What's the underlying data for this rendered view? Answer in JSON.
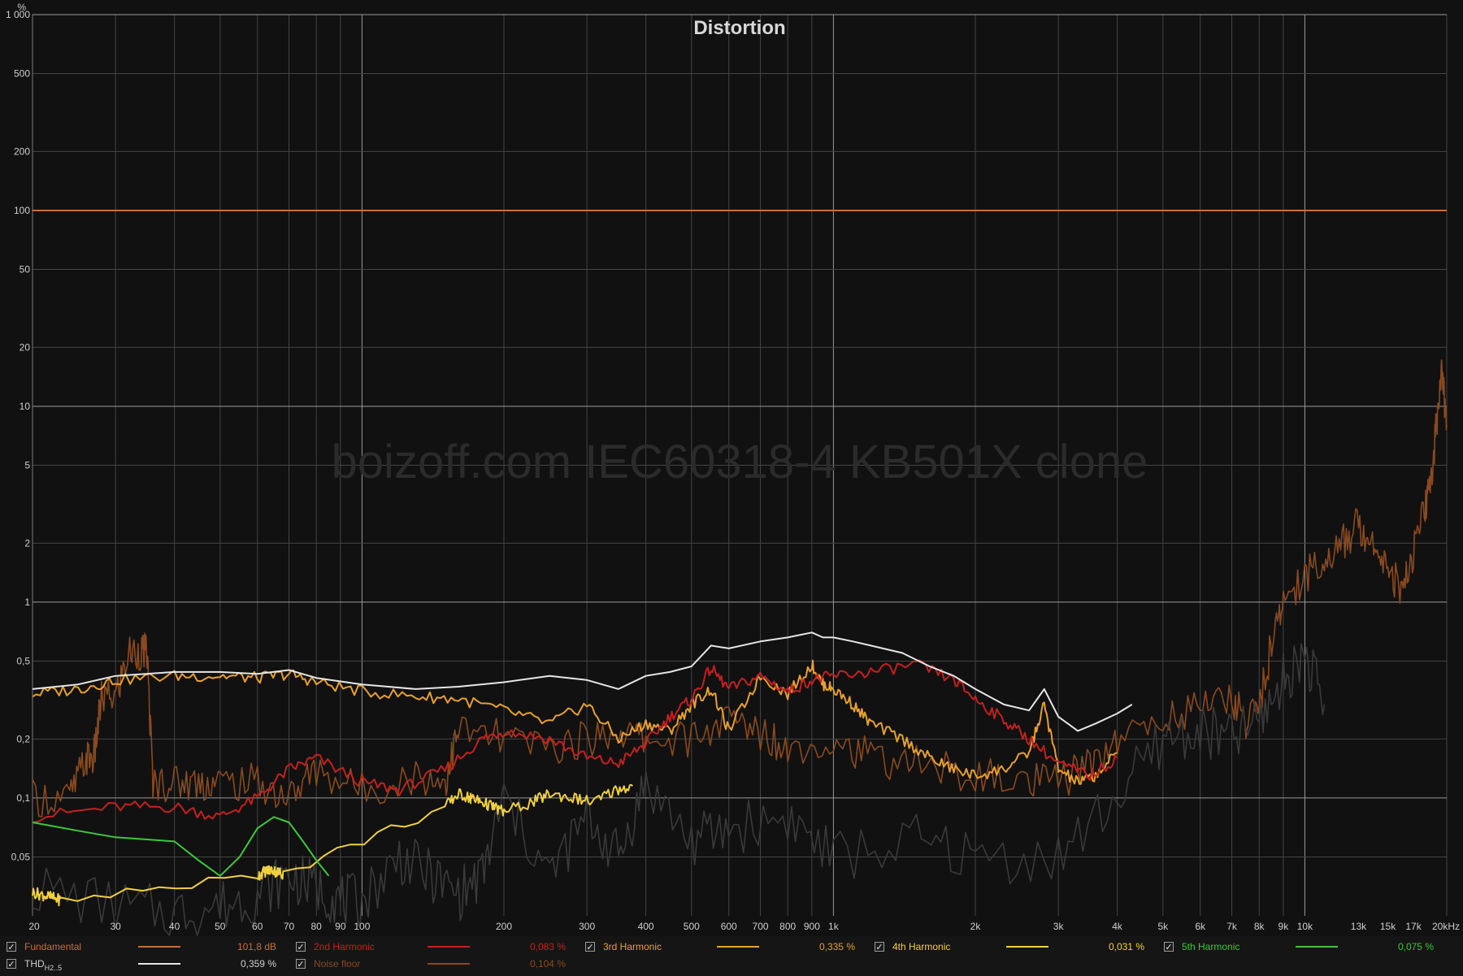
{
  "chart_data": {
    "type": "line",
    "title": "Distortion",
    "watermark": "boizoff.com IEC60318-4 KB501X clone",
    "x_scale": "log",
    "y_scale": "log",
    "xlim": [
      20,
      20000
    ],
    "ylim": [
      0.025,
      1000
    ],
    "y_unit": "%",
    "x_unit": "kHz",
    "grid": true,
    "y_ticks": [
      {
        "v": 1000,
        "label": "1 000"
      },
      {
        "v": 500,
        "label": "500"
      },
      {
        "v": 200,
        "label": "200"
      },
      {
        "v": 100,
        "label": "100"
      },
      {
        "v": 50,
        "label": "50"
      },
      {
        "v": 20,
        "label": "20"
      },
      {
        "v": 10,
        "label": "10"
      },
      {
        "v": 5,
        "label": "5"
      },
      {
        "v": 2,
        "label": "2"
      },
      {
        "v": 1,
        "label": "1"
      },
      {
        "v": 0.5,
        "label": "0,5"
      },
      {
        "v": 0.2,
        "label": "0,2"
      },
      {
        "v": 0.1,
        "label": "0,1"
      },
      {
        "v": 0.05,
        "label": "0,05"
      }
    ],
    "x_ticks": [
      {
        "v": 20,
        "label": "20"
      },
      {
        "v": 30,
        "label": "30"
      },
      {
        "v": 40,
        "label": "40"
      },
      {
        "v": 50,
        "label": "50"
      },
      {
        "v": 60,
        "label": "60"
      },
      {
        "v": 70,
        "label": "70"
      },
      {
        "v": 80,
        "label": "80"
      },
      {
        "v": 90,
        "label": "90"
      },
      {
        "v": 100,
        "label": "100"
      },
      {
        "v": 200,
        "label": "200"
      },
      {
        "v": 300,
        "label": "300"
      },
      {
        "v": 400,
        "label": "400"
      },
      {
        "v": 500,
        "label": "500"
      },
      {
        "v": 600,
        "label": "600"
      },
      {
        "v": 700,
        "label": "700"
      },
      {
        "v": 800,
        "label": "800"
      },
      {
        "v": 900,
        "label": "900"
      },
      {
        "v": 1000,
        "label": "1k"
      },
      {
        "v": 2000,
        "label": "2k"
      },
      {
        "v": 3000,
        "label": "3k"
      },
      {
        "v": 4000,
        "label": "4k"
      },
      {
        "v": 5000,
        "label": "5k"
      },
      {
        "v": 6000,
        "label": "6k"
      },
      {
        "v": 7000,
        "label": "7k"
      },
      {
        "v": 8000,
        "label": "8k"
      },
      {
        "v": 9000,
        "label": "9k"
      },
      {
        "v": 10000,
        "label": "10k"
      },
      {
        "v": 13000,
        "label": "13k"
      },
      {
        "v": 15000,
        "label": "15k"
      },
      {
        "v": 17000,
        "label": "17k"
      },
      {
        "v": 20000,
        "label": "20kHz"
      }
    ],
    "series": [
      {
        "name": "Fundamental",
        "color": "#c5703a",
        "value_label": "101,8 dB",
        "x": [
          20,
          20000
        ],
        "y": [
          100,
          100
        ]
      },
      {
        "name": "THD",
        "name_sub": "H2..5",
        "color": "#e6e6e6",
        "value_label": "0,359 %",
        "x": [
          20,
          25,
          30,
          40,
          50,
          60,
          70,
          80,
          100,
          130,
          160,
          200,
          250,
          300,
          350,
          400,
          450,
          500,
          550,
          600,
          700,
          800,
          900,
          950,
          1000,
          1100,
          1200,
          1400,
          1600,
          1800,
          2000,
          2300,
          2600,
          2800,
          3000,
          3300,
          3600,
          4000,
          4300
        ],
        "y": [
          0.36,
          0.38,
          0.42,
          0.44,
          0.44,
          0.43,
          0.45,
          0.41,
          0.38,
          0.36,
          0.37,
          0.39,
          0.42,
          0.4,
          0.36,
          0.42,
          0.44,
          0.47,
          0.6,
          0.58,
          0.63,
          0.66,
          0.7,
          0.66,
          0.66,
          0.63,
          0.6,
          0.55,
          0.47,
          0.42,
          0.36,
          0.3,
          0.28,
          0.36,
          0.26,
          0.22,
          0.24,
          0.27,
          0.3
        ]
      },
      {
        "name": "2nd Harmonic",
        "color": "#c42020",
        "value_label": "0,083 %",
        "x": [
          20,
          30,
          40,
          50,
          60,
          70,
          80,
          100,
          120,
          150,
          180,
          200,
          250,
          300,
          350,
          400,
          450,
          500,
          550,
          600,
          700,
          800,
          900,
          1000,
          1200,
          1500,
          1800,
          2000,
          2300,
          2600,
          3000,
          3500,
          4000
        ],
        "y": [
          0.08,
          0.09,
          0.09,
          0.08,
          0.1,
          0.14,
          0.16,
          0.12,
          0.11,
          0.14,
          0.2,
          0.22,
          0.2,
          0.16,
          0.15,
          0.19,
          0.26,
          0.32,
          0.46,
          0.36,
          0.42,
          0.35,
          0.4,
          0.42,
          0.44,
          0.48,
          0.4,
          0.32,
          0.25,
          0.2,
          0.15,
          0.13,
          0.16
        ]
      },
      {
        "name": "3rd Harmonic",
        "color": "#e8a030",
        "value_label": "0,335 %",
        "x": [
          20,
          25,
          30,
          40,
          50,
          60,
          70,
          80,
          100,
          130,
          160,
          200,
          250,
          300,
          350,
          400,
          450,
          500,
          550,
          600,
          700,
          800,
          900,
          950,
          1000,
          1100,
          1200,
          1400,
          1600,
          1800,
          2000,
          2300,
          2600,
          2800,
          3000,
          3300,
          3600,
          4000
        ],
        "y": [
          0.34,
          0.36,
          0.4,
          0.42,
          0.42,
          0.41,
          0.43,
          0.39,
          0.35,
          0.33,
          0.32,
          0.28,
          0.24,
          0.3,
          0.2,
          0.24,
          0.22,
          0.3,
          0.36,
          0.22,
          0.42,
          0.34,
          0.48,
          0.38,
          0.36,
          0.3,
          0.24,
          0.2,
          0.16,
          0.14,
          0.13,
          0.14,
          0.17,
          0.3,
          0.14,
          0.12,
          0.13,
          0.17
        ]
      },
      {
        "name": "4th Harmonic",
        "color": "#f0d040",
        "value_label": "0,031 %",
        "x": [
          20,
          21,
          22,
          23,
          60,
          62,
          64,
          66,
          68,
          150,
          160,
          170,
          170,
          180,
          190,
          200,
          230,
          250,
          280,
          310,
          345,
          375
        ],
        "y": [
          0.033,
          0.032,
          0.031,
          0.03,
          0.04,
          0.042,
          0.043,
          0.042,
          0.041,
          0.09,
          0.105,
          0.1,
          0.1,
          0.095,
          0.09,
          0.085,
          0.095,
          0.105,
          0.1,
          0.095,
          0.11,
          0.115
        ]
      },
      {
        "name": "5th Harmonic",
        "color": "#3cc83c",
        "value_label": "0,075 %",
        "x": [
          20,
          25,
          30,
          40,
          45,
          50,
          55,
          60,
          65,
          70,
          75,
          80,
          85
        ],
        "y": [
          0.075,
          0.068,
          0.063,
          0.06,
          0.048,
          0.04,
          0.05,
          0.07,
          0.08,
          0.075,
          0.06,
          0.048,
          0.04
        ]
      },
      {
        "name": "Noise floor",
        "color": "#8a4a20",
        "value_label": "0,104 %",
        "x": [
          20,
          24,
          26,
          27,
          28,
          30,
          32,
          34,
          35,
          36,
          40,
          45,
          50,
          60,
          70,
          80,
          100,
          130,
          150,
          160,
          200,
          250,
          300,
          350,
          400,
          500,
          600,
          700,
          800,
          1000,
          1200,
          1500,
          2000,
          2500,
          3000,
          3500,
          4000,
          5000,
          6000,
          7000,
          7500,
          8000,
          8500,
          9000,
          10000,
          11000,
          12000,
          13000,
          14000,
          15000,
          16000,
          17000,
          18000,
          18500,
          19000,
          19500,
          20000
        ],
        "y": [
          0.1,
          0.1,
          0.16,
          0.16,
          0.32,
          0.33,
          0.55,
          0.56,
          0.55,
          0.12,
          0.12,
          0.12,
          0.12,
          0.12,
          0.1,
          0.14,
          0.11,
          0.13,
          0.12,
          0.22,
          0.2,
          0.18,
          0.2,
          0.22,
          0.2,
          0.2,
          0.25,
          0.22,
          0.18,
          0.2,
          0.16,
          0.15,
          0.13,
          0.12,
          0.12,
          0.15,
          0.2,
          0.25,
          0.3,
          0.32,
          0.25,
          0.3,
          0.6,
          1.0,
          1.4,
          1.6,
          2.0,
          2.5,
          2.0,
          1.6,
          1.1,
          1.8,
          3.0,
          4.0,
          8.0,
          15.0,
          8.0
        ]
      },
      {
        "name": "",
        "color": "#3a3a3a",
        "value_label": "",
        "x": [
          20,
          30,
          40,
          50,
          60,
          70,
          80,
          90,
          100,
          120,
          140,
          160,
          180,
          200,
          250,
          300,
          350,
          400,
          500,
          600,
          800,
          1000,
          1500,
          2000,
          3000,
          4000,
          5000,
          6000,
          7000,
          8000,
          9000,
          10000,
          11000
        ],
        "y": [
          0.035,
          0.028,
          0.026,
          0.028,
          0.032,
          0.04,
          0.035,
          0.03,
          0.03,
          0.05,
          0.04,
          0.032,
          0.04,
          0.1,
          0.04,
          0.08,
          0.05,
          0.12,
          0.06,
          0.07,
          0.08,
          0.05,
          0.06,
          0.05,
          0.05,
          0.1,
          0.2,
          0.22,
          0.2,
          0.25,
          0.4,
          0.55,
          0.3
        ]
      }
    ]
  },
  "legend": {
    "check_glyph": "✓",
    "rows": [
      [
        {
          "name": "Fundamental",
          "value": "101,8 dB",
          "color": "#c5703a"
        },
        {
          "name": "2nd Harmonic",
          "value": "0,083 %",
          "color": "#c42020"
        },
        {
          "name": "3rd Harmonic",
          "value": "0,335 %",
          "color": "#e8a030"
        },
        {
          "name": "4th Harmonic",
          "value": "0,031 %",
          "color": "#f0d040"
        },
        {
          "name": "5th Harmonic",
          "value": "0,075 %",
          "color": "#3cc83c"
        }
      ],
      [
        {
          "name": "THD",
          "sub": "H2..5",
          "value": "0,359 %",
          "color": "#e6e6e6",
          "text_color": "#d0d0d0"
        },
        {
          "name": "Noise floor",
          "value": "0,104 %",
          "color": "#8a4a20"
        }
      ]
    ]
  }
}
